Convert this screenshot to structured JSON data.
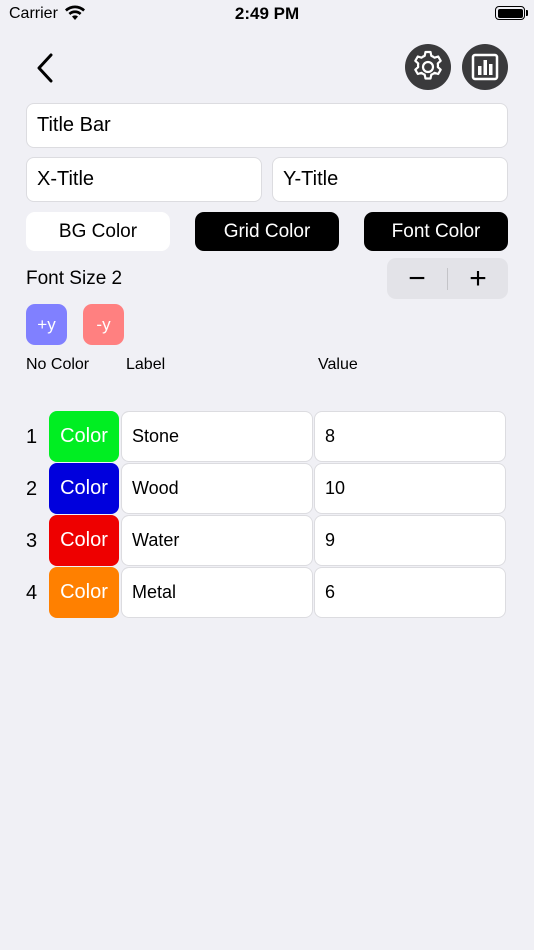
{
  "status_bar": {
    "carrier": "Carrier",
    "time": "2:49 PM"
  },
  "nav": {
    "back_icon": "chevron-left-icon",
    "settings_icon": "gear-icon",
    "chart_icon": "bar-chart-icon"
  },
  "fields": {
    "title": "Title Bar",
    "x_title": "X-Title",
    "y_title": "Y-Title"
  },
  "color_buttons": {
    "bg": "BG Color",
    "grid": "Grid Color",
    "font": "Font Color"
  },
  "font_size": {
    "label": "Font Size 2",
    "minus": "−",
    "plus": "+"
  },
  "axis_buttons": {
    "plus_y": "+y",
    "minus_y": "-y",
    "plus_y_color": "#8080ff",
    "minus_y_color": "#ff8080"
  },
  "columns": {
    "no_color": "No Color",
    "label": "Label",
    "value": "Value"
  },
  "rows": [
    {
      "num": "1",
      "color_label": "Color",
      "color": "#00ee22",
      "label": "Stone",
      "value": "8"
    },
    {
      "num": "2",
      "color_label": "Color",
      "color": "#0000dd",
      "label": "Wood",
      "value": "10"
    },
    {
      "num": "3",
      "color_label": "Color",
      "color": "#ee0000",
      "label": "Water",
      "value": "9"
    },
    {
      "num": "4",
      "color_label": "Color",
      "color": "#ff8000",
      "label": "Metal",
      "value": "6"
    }
  ]
}
